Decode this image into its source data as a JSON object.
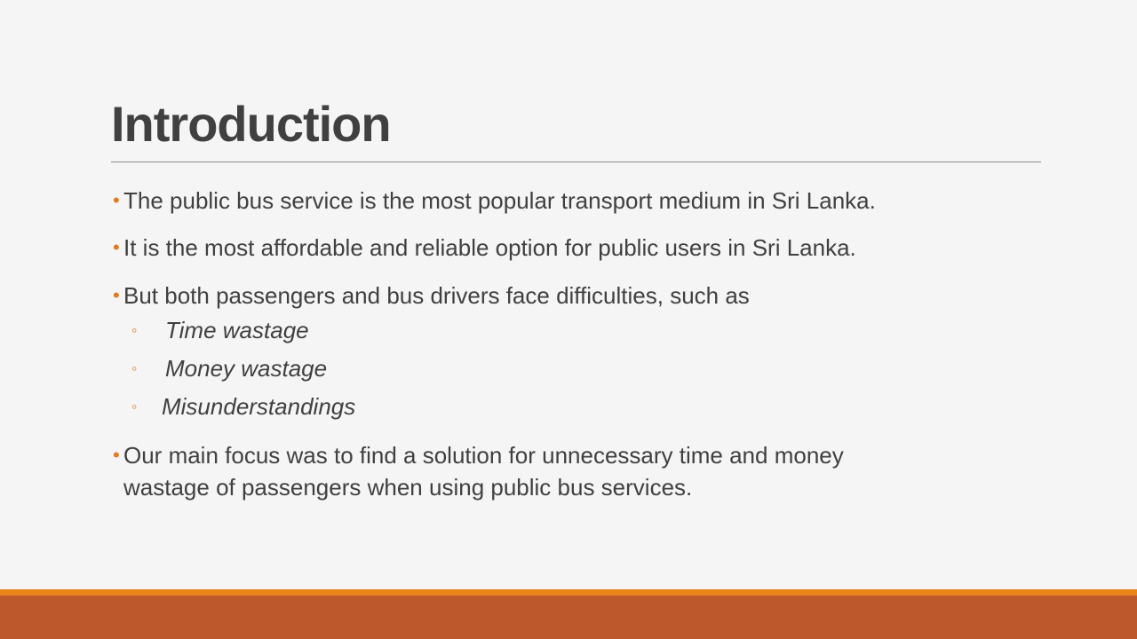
{
  "slide": {
    "title": "Introduction",
    "bullets": [
      {
        "bullet_glyph": "•",
        "text": "The public bus service is the most popular transport medium in Sri Lanka."
      },
      {
        "bullet_glyph": "•",
        "text": "It is the most affordable and reliable option for public users in Sri Lanka."
      },
      {
        "bullet_glyph": "•",
        "text": "But both passengers and bus drivers face difficulties, such  as"
      },
      {
        "bullet_glyph": "•",
        "text_line1": "Our main focus was to find a  solution for unnecessary time and money",
        "text_line2": "wastage of passengers when using public bus services."
      }
    ],
    "sub_bullets": [
      {
        "bullet_glyph": "◦",
        "text": " Time wastage"
      },
      {
        "bullet_glyph": "◦",
        "text": " Money wastage"
      },
      {
        "bullet_glyph": "◦",
        "text": "Misunderstandings"
      }
    ]
  },
  "colors": {
    "accent_orange": "#e8861a",
    "footer_rust": "#bd582c",
    "bullet_orange": "#e07b20",
    "text": "#404040",
    "background": "#f5f5f5"
  }
}
